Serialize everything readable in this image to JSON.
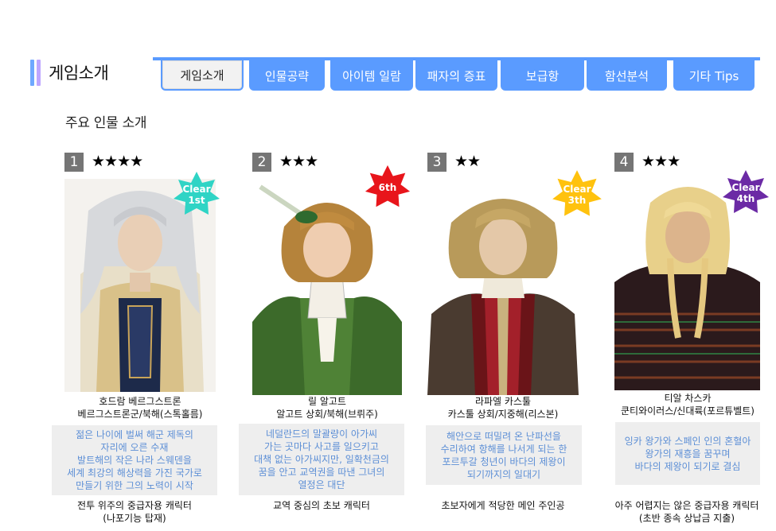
{
  "section": {
    "title": "게임소개"
  },
  "tabs": [
    {
      "label": "게임소개",
      "active": true
    },
    {
      "label": "인물공략",
      "active": false
    },
    {
      "label": "아이템 일람",
      "active": false
    },
    {
      "label": "패자의 증표",
      "active": false
    },
    {
      "label": "보급항",
      "active": false
    },
    {
      "label": "함선분석",
      "active": false
    },
    {
      "label": "기타 Tips",
      "active": false
    }
  ],
  "subtitle": "주요 인물 소개",
  "characters": [
    {
      "number": "1",
      "stars": "★★★★",
      "badge": {
        "line1": "Clear",
        "line2": "1st",
        "color": "#2fd4c5"
      },
      "name": "호드람 베르그스트론",
      "origin": "베르그스트론군/북해(스톡홀름)",
      "desc": [
        "젊은 나이에 벌써 해군 제독의",
        "자리에 오른 수재",
        "발트해의 작은 나라 스웨덴을",
        "세계 최강의 해상력을 가진 국가로",
        "만들기 위한 그의 노력이 시작"
      ],
      "foot": [
        "전투 위주의 중급자용 캐릭터",
        "(나포기능 탑재)"
      ]
    },
    {
      "number": "2",
      "stars": "★★★",
      "badge": {
        "line1": "6th",
        "line2": "",
        "color": "#e8151b"
      },
      "name": "릴 알고트",
      "origin": "알고트 상회/북해(브뤼주)",
      "desc": [
        "네덜란드의 말괄량이 아가씨",
        "가는 곳마다 사고를 일으키고",
        "대책 없는 아가씨지만, 일확천금의",
        "꿈을 안고 교역권을 따낸 그녀의",
        "열정은 대단"
      ],
      "foot": [
        "교역 중심의 초보 캐릭터"
      ]
    },
    {
      "number": "3",
      "stars": "★★",
      "badge": {
        "line1": "Clear",
        "line2": "3th",
        "color": "#ffc20e"
      },
      "name": "라파엘 카스툴",
      "origin": "카스툴 상회/지중해(리스본)",
      "desc": [
        "해안으로 떠밀려 온 난파선을",
        "수리하여 항해를 나서게 되는 한",
        "포르투갈 청년이 바다의 제왕이",
        "되기까지의 일대기"
      ],
      "foot": [
        "초보자에게 적당한 메인 주인공"
      ]
    },
    {
      "number": "4",
      "stars": "★★★",
      "badge": {
        "line1": "Clear",
        "line2": "4th",
        "color": "#6b2aa5"
      },
      "name": "티알 차스카",
      "origin": "쿤티와이러스/신대륙(포르튜벨트)",
      "desc": [
        "잉카 왕가와 스페인 인의 혼혈아",
        "왕가의 재흥을 꿈꾸며",
        "바다의 제왕이 되기로 결심"
      ],
      "foot": [
        "아주 어렵지는 않은 중급자용 캐릭터",
        "(초반 종속 상납금 지출)"
      ]
    }
  ]
}
